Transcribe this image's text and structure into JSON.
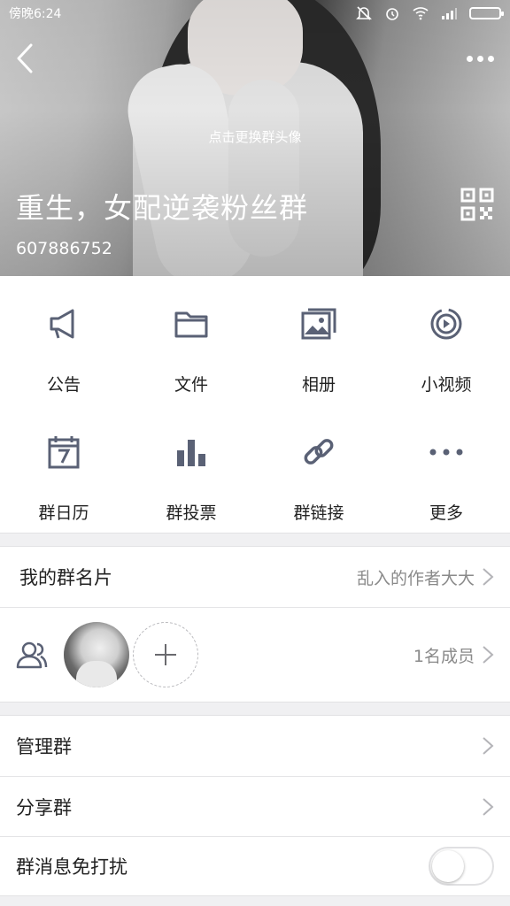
{
  "status": {
    "time": "傍晚6:24"
  },
  "header": {
    "change_avatar_hint": "点击更换群头像",
    "group_name": "重生，女配逆袭粉丝群",
    "group_id": "607886752"
  },
  "grid": [
    {
      "label": "公告",
      "icon": "megaphone-icon"
    },
    {
      "label": "文件",
      "icon": "folder-icon"
    },
    {
      "label": "相册",
      "icon": "photo-album-icon"
    },
    {
      "label": "小视频",
      "icon": "video-icon"
    },
    {
      "label": "群日历",
      "icon": "calendar-icon"
    },
    {
      "label": "群投票",
      "icon": "bar-chart-icon"
    },
    {
      "label": "群链接",
      "icon": "link-icon"
    },
    {
      "label": "更多",
      "icon": "more-dots-icon"
    }
  ],
  "card": {
    "title": "我的群名片",
    "value": "乱入的作者大大"
  },
  "members": {
    "count_label": "1名成员"
  },
  "rows": {
    "manage": "管理群",
    "share": "分享群",
    "mute": "群消息免打扰"
  },
  "colors": {
    "icon": "#5a6175",
    "muted": "#8a8a8a",
    "divider": "#e4e4e6"
  }
}
